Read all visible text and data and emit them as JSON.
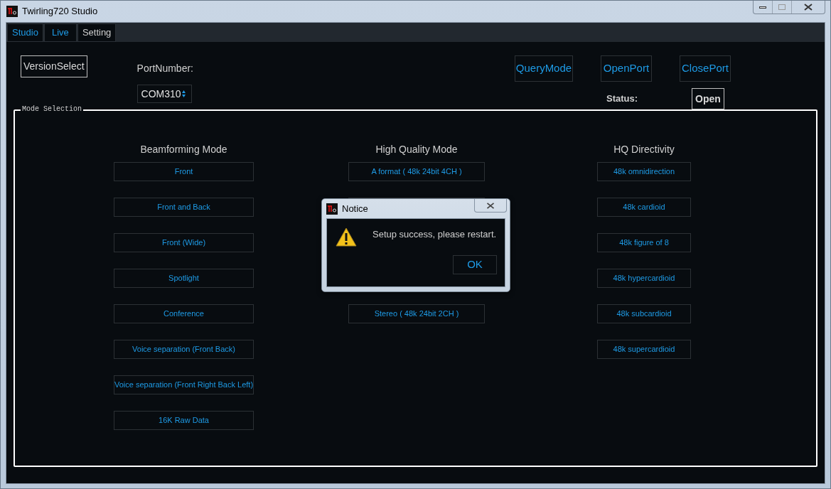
{
  "window": {
    "title": "Twirling720 Studio"
  },
  "tabs": [
    {
      "label": "Studio",
      "selected": false
    },
    {
      "label": "Live",
      "selected": false
    },
    {
      "label": "Setting",
      "selected": true
    }
  ],
  "toolbar": {
    "version_button": "VersionSelect",
    "port_label": "PortNumber:",
    "port_value": "COM310",
    "query_button": "QueryMode",
    "open_button": "OpenPort",
    "close_button": "ClosePort",
    "status_label": "Status:",
    "status_value": "Open"
  },
  "mode_selection": {
    "title": "Mode Selection",
    "columns": [
      {
        "heading": "Beamforming Mode",
        "items": [
          {
            "kind": "button",
            "label": "Front"
          },
          {
            "kind": "button",
            "label": "Front and Back"
          },
          {
            "kind": "button",
            "label": "Front (Wide)"
          },
          {
            "kind": "button",
            "label": "Spotlight"
          },
          {
            "kind": "button",
            "label": "Conference"
          },
          {
            "kind": "button",
            "label": "Voice separation (Front Back)"
          },
          {
            "kind": "button",
            "label": "Voice separation (Front Right Back Left)"
          },
          {
            "kind": "button",
            "label": "16K Raw Data"
          }
        ]
      },
      {
        "heading": "High Quality Mode",
        "items": [
          {
            "kind": "button",
            "label": "A format ( 48k 24bit 4CH )"
          },
          {
            "kind": "covered"
          },
          {
            "kind": "covered"
          },
          {
            "kind": "covered"
          },
          {
            "kind": "button",
            "label": "Stereo ( 48k 24bit 2CH )"
          }
        ]
      },
      {
        "heading": "HQ Directivity",
        "items": [
          {
            "kind": "button",
            "label": "48k omnidirection"
          },
          {
            "kind": "button",
            "label": "48k cardioid"
          },
          {
            "kind": "button",
            "label": "48k figure of 8"
          },
          {
            "kind": "button",
            "label": "48k hypercardioid"
          },
          {
            "kind": "button",
            "label": "48k subcardioid"
          },
          {
            "kind": "button",
            "label": "48k supercardioid"
          }
        ]
      }
    ]
  },
  "dialog": {
    "title": "Notice",
    "message": "Setup success, please restart.",
    "button": "OK"
  }
}
